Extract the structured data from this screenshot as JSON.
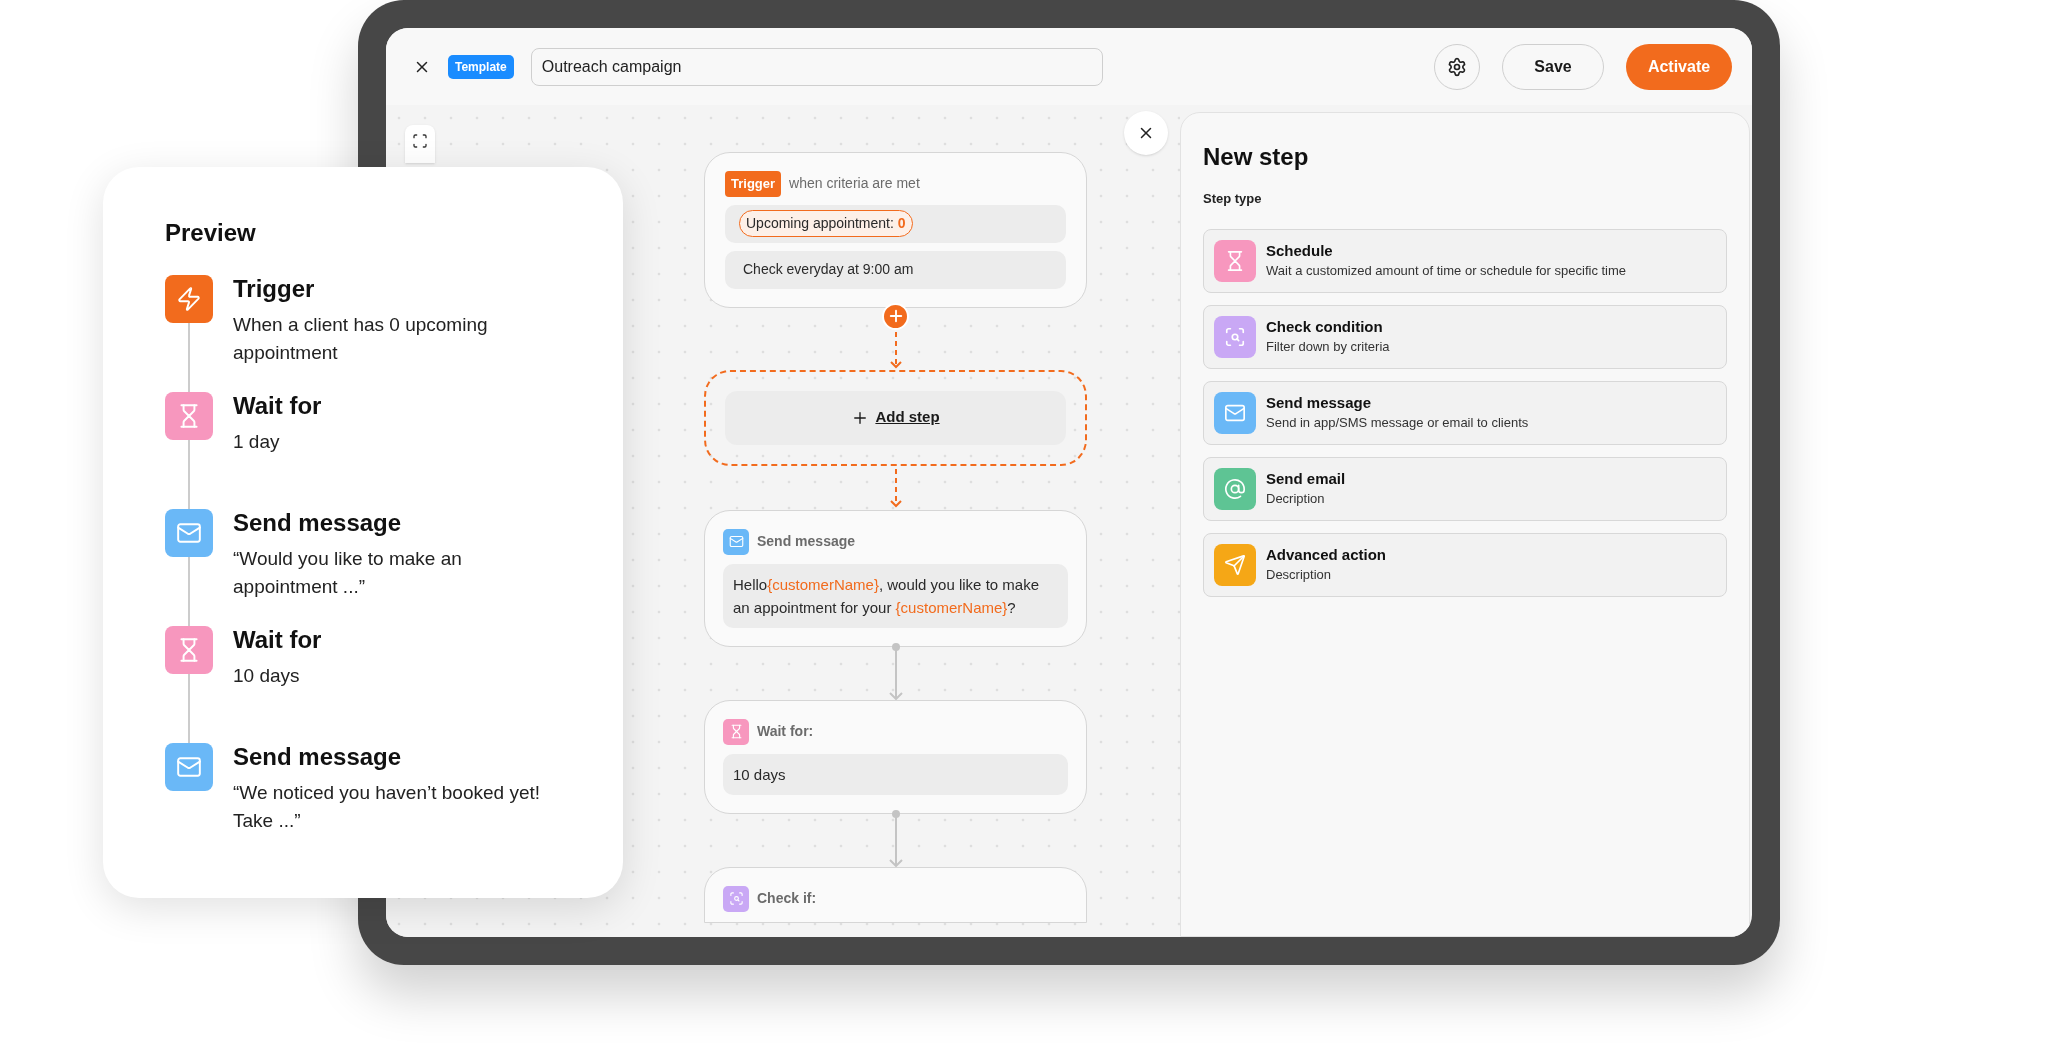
{
  "editor": {
    "badge": "Template",
    "campaign_name": "Outreach campaign",
    "buttons": [
      {
        "label": "Save",
        "kind": "secondary"
      },
      {
        "label": "Activate",
        "kind": "primary"
      }
    ]
  },
  "canvas": {
    "nodes": [
      {
        "kind": "trigger",
        "badge": "Trigger",
        "caption": "when criteria are met",
        "criterion": {
          "label": "Upcoming appointment:",
          "value": "0"
        },
        "schedule": "Check everyday at 9:00 am"
      },
      {
        "kind": "add_step",
        "label": "Add step"
      },
      {
        "kind": "message",
        "title": "Send message",
        "text_parts": [
          {
            "text": "Hello",
            "variable": false
          },
          {
            "text": "{customerName}",
            "variable": true
          },
          {
            "text": ", would you like to make an appointment for your ",
            "variable": false
          },
          {
            "text": "{customerName}",
            "variable": true
          },
          {
            "text": "?",
            "variable": false
          }
        ]
      },
      {
        "kind": "schedule",
        "title": "Wait for:",
        "text_parts": [
          {
            "text": "10 days",
            "variable": false
          }
        ]
      },
      {
        "kind": "condition",
        "title": "Check if:"
      }
    ]
  },
  "panel": {
    "title": "New step",
    "section": "Step type",
    "options": [
      {
        "kind": "schedule",
        "title": "Schedule",
        "description": "Wait a customized amount of time or schedule for specific time"
      },
      {
        "kind": "condition",
        "title": "Check condition",
        "description": "Filter down by criteria"
      },
      {
        "kind": "message",
        "title": "Send message",
        "description": "Send in app/SMS message or email to clients"
      },
      {
        "kind": "email",
        "title": "Send email",
        "description": "Decription"
      },
      {
        "kind": "advanced",
        "title": "Advanced action",
        "description": "Description"
      }
    ]
  },
  "preview": {
    "title": "Preview",
    "steps": [
      {
        "kind": "trigger",
        "title": "Trigger",
        "text": "When a client has 0 upcoming appointment"
      },
      {
        "kind": "schedule",
        "title": "Wait for",
        "text": "1 day"
      },
      {
        "kind": "message",
        "title": "Send message",
        "text": "“Would you like to make an appointment ...”"
      },
      {
        "kind": "schedule",
        "title": "Wait for",
        "text": "10 days"
      },
      {
        "kind": "message",
        "title": "Send message",
        "text": "“We noticed you haven’t booked yet! Take ...”"
      }
    ]
  }
}
